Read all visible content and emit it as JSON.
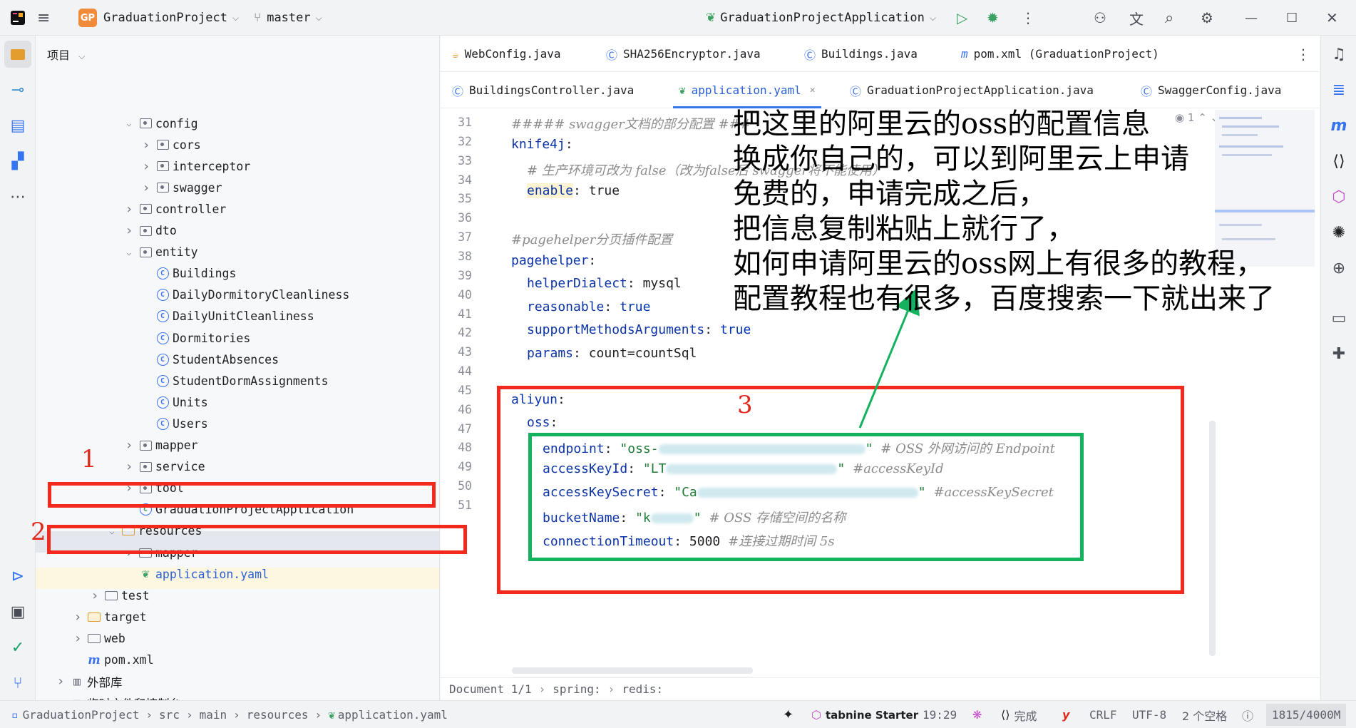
{
  "titlebar": {
    "project_badge": "GP",
    "project_name": "GraduationProject",
    "branch": "master",
    "run_config": "GraduationProjectApplication"
  },
  "project_panel": {
    "title": "项目",
    "tree": [
      {
        "label": "config",
        "type": "package",
        "level": 3,
        "expanded": true
      },
      {
        "label": "cors",
        "type": "package",
        "level": 4,
        "expanded": false
      },
      {
        "label": "interceptor",
        "type": "package",
        "level": 4,
        "expanded": false
      },
      {
        "label": "swagger",
        "type": "package",
        "level": 4,
        "expanded": false
      },
      {
        "label": "controller",
        "type": "package",
        "level": 3,
        "expanded": false
      },
      {
        "label": "dto",
        "type": "package",
        "level": 3,
        "expanded": false
      },
      {
        "label": "entity",
        "type": "package",
        "level": 3,
        "expanded": true
      },
      {
        "label": "Buildings",
        "type": "class",
        "level": 4
      },
      {
        "label": "DailyDormitoryCleanliness",
        "type": "class",
        "level": 4
      },
      {
        "label": "DailyUnitCleanliness",
        "type": "class",
        "level": 4
      },
      {
        "label": "Dormitories",
        "type": "class",
        "level": 4
      },
      {
        "label": "StudentAbsences",
        "type": "class",
        "level": 4
      },
      {
        "label": "StudentDormAssignments",
        "type": "class",
        "level": 4
      },
      {
        "label": "Units",
        "type": "class",
        "level": 4
      },
      {
        "label": "Users",
        "type": "class",
        "level": 4
      },
      {
        "label": "mapper",
        "type": "package",
        "level": 3,
        "expanded": false
      },
      {
        "label": "service",
        "type": "package",
        "level": 3,
        "expanded": false
      },
      {
        "label": "tool",
        "type": "package",
        "level": 3,
        "expanded": false
      },
      {
        "label": "GraduationProjectApplication",
        "type": "app",
        "level": 3
      },
      {
        "label": "resources",
        "type": "resfolder",
        "level": 2,
        "expanded": true
      },
      {
        "label": "mapper",
        "type": "folder",
        "level": 3,
        "expanded": false
      },
      {
        "label": "application.yaml",
        "type": "yaml",
        "level": 3,
        "selected": true
      },
      {
        "label": "test",
        "type": "folder",
        "level": 1,
        "expanded": false
      },
      {
        "label": "target",
        "type": "orangefolder",
        "level": 0,
        "expanded": false
      },
      {
        "label": "web",
        "type": "folder",
        "level": 0,
        "expanded": false
      },
      {
        "label": "pom.xml",
        "type": "maven",
        "level": 0
      },
      {
        "label": "外部库",
        "type": "lib",
        "level": -1,
        "expanded": false
      },
      {
        "label": "临时文件和控制台",
        "type": "scratch",
        "level": -1,
        "expanded": false
      }
    ]
  },
  "tabs_row1": [
    {
      "label": "WebConfig.java",
      "icon": "java-icon"
    },
    {
      "label": "SHA256Encryptor.java",
      "icon": "class-icon"
    },
    {
      "label": "Buildings.java",
      "icon": "class-icon"
    },
    {
      "label": "pom.xml (GraduationProject)",
      "icon": "maven-icon"
    }
  ],
  "tabs_row2": [
    {
      "label": "BuildingsController.java",
      "icon": "class-icon"
    },
    {
      "label": "application.yaml",
      "icon": "yaml-icon",
      "active": true
    },
    {
      "label": "GraduationProjectApplication.java",
      "icon": "app-icon"
    },
    {
      "label": "SwaggerConfig.java",
      "icon": "class-icon"
    }
  ],
  "editor": {
    "line_numbers": [
      "31",
      "32",
      "33",
      "34",
      "35",
      "36",
      "37",
      "38",
      "39",
      "40",
      "41",
      "42",
      "43",
      "44",
      "45",
      "46",
      "47",
      "48",
      "49",
      "50",
      "51"
    ],
    "code": {
      "l31_comment": "##### swagger文档的部分配置 ###",
      "l32_key": "knife4j",
      "l33_comment": "# 生产环境可改为 false（改为false后 swagger将不能使用）",
      "l34_key": "enable",
      "l34_val": "true",
      "l36_comment": "#pagehelper分页插件配置",
      "l37_key": "pagehelper",
      "l38_key": "helperDialect",
      "l38_val": "mysql",
      "l39_key": "reasonable",
      "l39_val": "true",
      "l40_key": "supportMethodsArguments",
      "l40_val": "true",
      "l41_key": "params",
      "l41_val": "count=countSql",
      "l43_key": "aliyun",
      "l44_key": "oss",
      "l45_key": "endpoint",
      "l45_val_prefix": "\"oss-",
      "l45_comment": "# OSS 外网访问的 Endpoint",
      "l46_key": "accessKeyId",
      "l46_val_prefix": "\"LT",
      "l46_comment": "#accessKeyId",
      "l47_key": "accessKeySecret",
      "l47_val_prefix": "\"Ca",
      "l47_comment": "#accessKeySecret",
      "l48_key": "bucketName",
      "l48_val_prefix": "\"k",
      "l48_comment": "# OSS 存储空间的名称",
      "l49_key": "connectionTimeout",
      "l49_val": "5000",
      "l49_comment": "#连接过期时间 5s",
      "quote": "\"",
      "colon": ":"
    },
    "inspection_count": "1",
    "breadcrumb": [
      "Document 1/1",
      "spring:",
      "redis:"
    ]
  },
  "annotation": {
    "lines": [
      "把这里的阿里云的oss的配置信息",
      "换成你自己的，可以到阿里云上申请",
      "免费的，申请完成之后，",
      "把信息复制粘贴上就行了，",
      "如何申请阿里云的oss网上有很多的教程，",
      "配置教程也有很多，百度搜索一下就出来了"
    ],
    "label1": "1",
    "label2": "2",
    "label3": "3",
    "red": "#f2291c",
    "green": "#14b25e"
  },
  "statusbar": {
    "path": [
      "GraduationProject",
      "src",
      "main",
      "resources",
      "application.yaml"
    ],
    "tabnine": "tabnine Starter",
    "position": "19:29",
    "done": "完成",
    "line_sep": "CRLF",
    "encoding": "UTF-8",
    "indent": "2 个空格",
    "memory": "1815/4000M"
  }
}
